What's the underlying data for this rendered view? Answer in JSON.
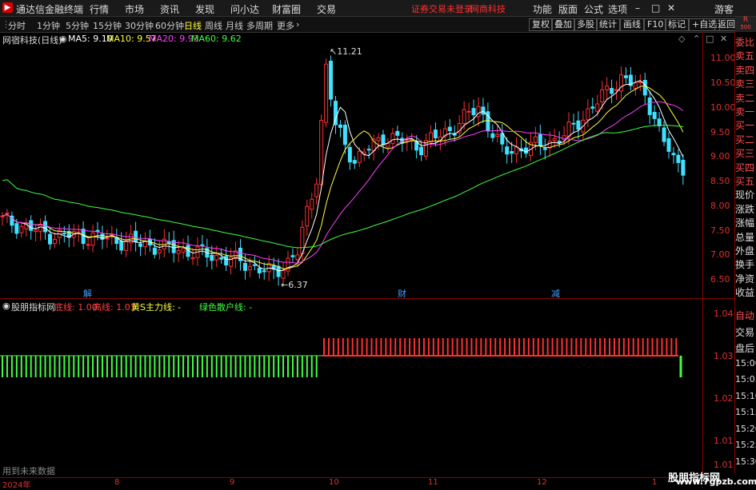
{
  "menu": {
    "app_title": "通达信金融终端",
    "items": [
      "行情",
      "市场",
      "资讯",
      "发现",
      "问小达",
      "财富圈",
      "交易"
    ],
    "notice": "证券交易未登录",
    "broker": "网商科技",
    "right_items": [
      "功能",
      "版面",
      "公式",
      "选项"
    ],
    "guest": "游客"
  },
  "toolbar": {
    "periods": [
      "分时",
      "1分钟",
      "5分钟",
      "15分钟",
      "30分钟",
      "60分钟",
      "日线",
      "周线",
      "月线",
      "多周期",
      "更多"
    ],
    "active_period": "日线",
    "right_buttons": [
      "复权",
      "叠加",
      "多股",
      "统计",
      "画线",
      "F10",
      "标记",
      "+自选",
      "返回"
    ]
  },
  "chart": {
    "stock_label": "网宿科技(日线)",
    "ma": [
      {
        "label": "MA5: 9.10",
        "color": "#ffffff"
      },
      {
        "label": "MA10: 9.57",
        "color": "#ffff40"
      },
      {
        "label": "MA20: 9.93",
        "color": "#ff40ff"
      },
      {
        "label": "MA60: 9.62",
        "color": "#40ff40"
      }
    ],
    "high_label": "11.21",
    "low_label": "6.37",
    "price_ticks": [
      "11.00",
      "10.50",
      "10.00",
      "9.50",
      "9.00",
      "8.50",
      "8.00",
      "7.50",
      "7.00",
      "6.50"
    ],
    "event_markers": [
      "解",
      "财",
      "减"
    ]
  },
  "indicator": {
    "name": "股朋指标网",
    "bottom_line": "底线: 1.00",
    "top_line": "高线: 1.03",
    "main_line": "黄S主力线: -",
    "retail_line": "绿色散户线: -",
    "ticks": [
      "1.04",
      "1.03",
      "1.02",
      "1.01",
      "1.01"
    ]
  },
  "timeaxis": {
    "labels": [
      "2024年",
      "8",
      "9",
      "10",
      "11",
      "12",
      "1"
    ]
  },
  "status": {
    "left": "用到未来数据"
  },
  "sidebar": {
    "top_labels": [
      "委比",
      "卖五",
      "卖四",
      "卖三",
      "卖二",
      "卖一",
      "买一",
      "买二",
      "买三",
      "买四",
      "买五",
      "现价",
      "涨跌",
      "涨幅",
      "总量",
      "外盘",
      "换手",
      "净资",
      "收益"
    ],
    "bottom_labels": [
      "自动",
      "交易",
      "盘后",
      "15:00",
      "15:05",
      "15:10",
      "15:15",
      "15:20",
      "15:25",
      "15:30"
    ],
    "r_badge": "R",
    "r_sub": "500"
  },
  "watermark": {
    "line1": "股朋指标网",
    "line2": "www.7gpzb.com"
  }
}
